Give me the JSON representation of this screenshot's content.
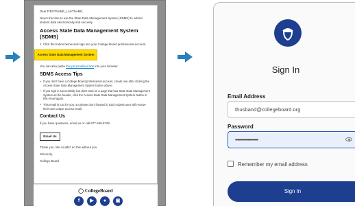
{
  "email": {
    "greeting": "Dear FIRSTNAME_LASTNAME,",
    "intro": "Now's the time to use the State Data Management System (SDMS) to submit student data electronically and securely.",
    "heading": "Access State Data Management System (SDMS)",
    "step": "1. Click the button below and sign into your College Board professional account.",
    "cta_label": "Access State Data Management System",
    "paste_prefix": "You can also paste ",
    "paste_link": "this personalized link",
    "paste_suffix": " into your browser.",
    "tips_heading": "SDMS Access Tips",
    "tips": [
      "If you don't have a College Board professional account, create one after clicking the Access State Data Management System button above.",
      "If you sign in successfully but don't land on a page that has State Data Management System as the header, click the Access State Data Management System button in this email again.",
      "This email is just for you, so please don't forward it. Each SDMS user will receive their own unique access email."
    ],
    "contact_heading": "Contact Us",
    "contact_text": "If you have questions, email us or call 877-349-9728.",
    "email_us_label": "Email Us",
    "thanks": "Thank you. We couldn't do this without you.",
    "sincerely": "Sincerely,",
    "signature": "College Board",
    "footer_logo": "CollegeBoard",
    "social_icons": [
      "facebook-icon",
      "youtube-icon",
      "twitter-icon",
      "instagram-icon"
    ],
    "social_glyphs": [
      "f",
      "▶",
      "●",
      "▣"
    ]
  },
  "signin": {
    "title": "Sign In",
    "email_label": "Email Address",
    "email_value": "thusband@collegeboard.org",
    "password_label": "Password",
    "password_value": "••••••••••••••••••••",
    "remember_label": "Remember my email address",
    "button_label": "Sign In"
  },
  "colors": {
    "brand_navy": "#1e3f8f",
    "cta_yellow": "#fedb00",
    "arrow_blue": "#2a82b8",
    "link_blue": "#0077c8"
  }
}
